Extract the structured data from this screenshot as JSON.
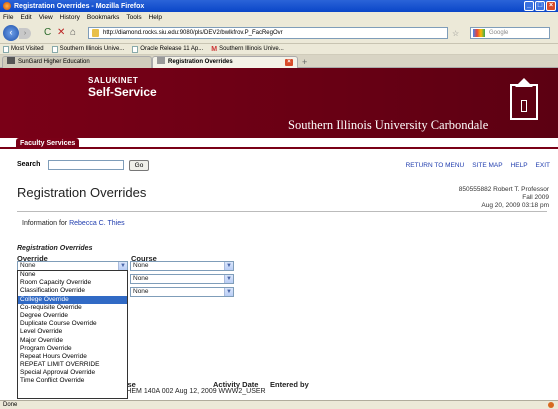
{
  "browser": {
    "window_title": "Registration Overrides - Mozilla Firefox",
    "menu": [
      "File",
      "Edit",
      "View",
      "History",
      "Bookmarks",
      "Tools",
      "Help"
    ],
    "url": "http://diamond.rocks.siu.edu:9080/pls/DEV2/bwlkfrov.P_FacRegOvr",
    "search_placeholder": "Google",
    "bookmarks": [
      "Most Visited",
      "Southern Illinois Unive...",
      "Oracle Release 11 Ap...",
      "Southern Illinois Unive..."
    ],
    "tabs": [
      {
        "label": "SunGard Higher Education",
        "active": false
      },
      {
        "label": "Registration Overrides",
        "active": true
      }
    ],
    "status": "Done"
  },
  "banner": {
    "brand_top": "SALUKINET",
    "brand_main": "Self-Service",
    "university": "Southern Illinois University Carbondale"
  },
  "nav": {
    "tab": "Faculty Services",
    "search_label": "Search",
    "go_label": "Go",
    "links": [
      "RETURN TO MENU",
      "SITE MAP",
      "HELP",
      "EXIT"
    ]
  },
  "page": {
    "heading": "Registration Overrides",
    "user_line": "850555882 Robert T. Professor",
    "term": "Fall 2009",
    "datetime": "Aug 20, 2009 03:18 pm",
    "info_prefix": "Information for",
    "student_name": "Rebecca C. Thies"
  },
  "form": {
    "section_title": "Registration Overrides",
    "col_override": "Override",
    "col_course": "Course",
    "override_value": "None",
    "course_values": [
      "None",
      "None",
      "None"
    ],
    "dropdown_options": [
      "None",
      "Room Capacity Override",
      "Classification Override",
      "College Override",
      "Co-requisite Override",
      "Degree Override",
      "Duplicate Course Override",
      "Level Override",
      "Major Override",
      "Program Override",
      "Repeat Hours Override",
      "REPEAT LIMIT OVERRIDE",
      "Special Approval Override",
      "Time Conflict Override"
    ],
    "highlighted_option": "College Override"
  },
  "existing": {
    "col_course": "urse",
    "col_activity": "Activity Date",
    "col_entered": "Entered by",
    "row": "Room Capacity Override 60832 - CHEM 140A 002 Aug 12, 2009 WWW2_USER"
  },
  "colors": {
    "banner": "#7a0017",
    "link": "#1f3cae",
    "selection": "#316ac5"
  }
}
